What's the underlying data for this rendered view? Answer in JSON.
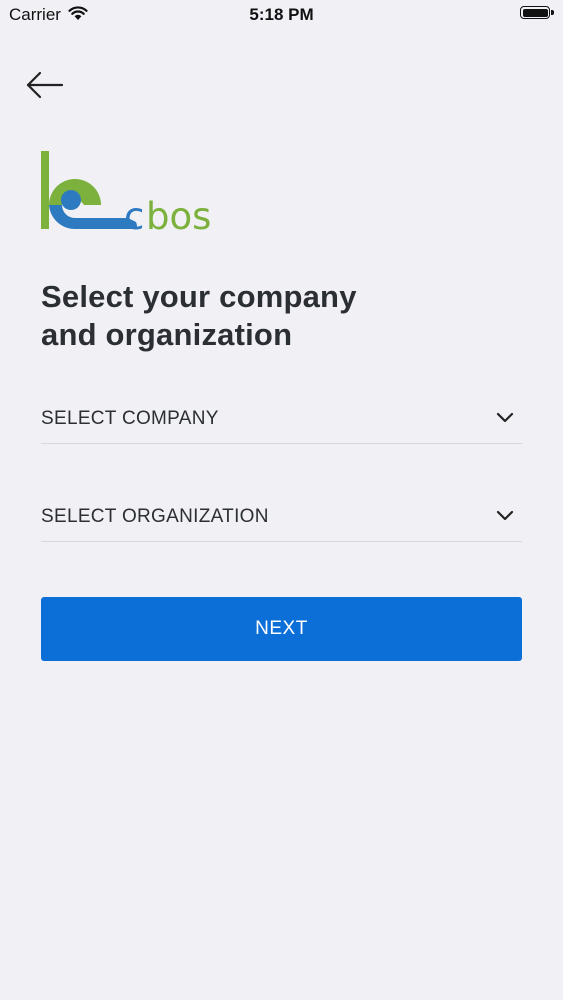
{
  "status_bar": {
    "carrier": "Carrier",
    "time": "5:18 PM",
    "battery_level": 1.0
  },
  "nav": {
    "back_icon": "arrow-left-icon"
  },
  "logo": {
    "text": "cbos",
    "colors": {
      "green": "#7bb13c",
      "blue": "#2e7ac0"
    }
  },
  "title": {
    "line1": "Select your company",
    "line2": "and organization"
  },
  "company_select": {
    "label": "SELECT COMPANY",
    "icon": "chevron-down-icon"
  },
  "organization_select": {
    "label": "SELECT ORGANIZATION",
    "icon": "chevron-down-icon"
  },
  "next_button": {
    "label": "NEXT",
    "color": "#0c6fd7"
  }
}
